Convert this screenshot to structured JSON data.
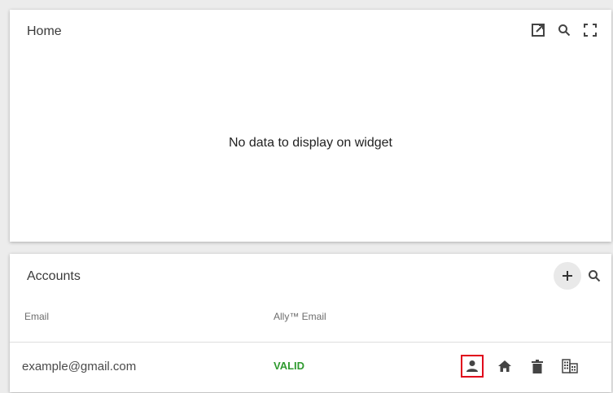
{
  "home_widget": {
    "title": "Home",
    "empty_message": "No data to display on widget",
    "tools": [
      {
        "icon": "open-in-new-icon"
      },
      {
        "icon": "search-icon"
      },
      {
        "icon": "fullscreen-icon"
      }
    ]
  },
  "accounts_widget": {
    "title": "Accounts",
    "tools": [
      {
        "icon": "add-icon"
      },
      {
        "icon": "search-icon"
      }
    ],
    "columns": [
      "Email",
      "Ally™ Email"
    ],
    "rows": [
      {
        "email": "example@gmail.com",
        "status": "VALID",
        "actions": [
          "person-icon",
          "home-icon",
          "trash-icon",
          "building-icon"
        ]
      }
    ]
  },
  "colors": {
    "status_valid": "#2f9a2f",
    "highlight_border": "#e0001b",
    "icon": "#444444"
  }
}
